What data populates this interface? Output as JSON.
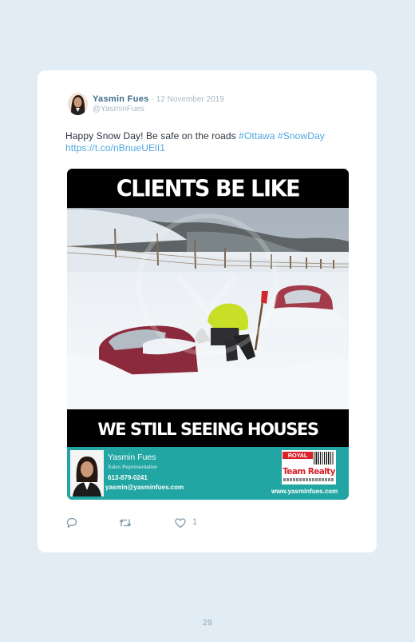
{
  "tweet": {
    "display_name": "Yasmin Fues",
    "date": "· 12 November 2019",
    "handle": "@YasminFues",
    "text_plain": "Happy Snow Day! Be safe on the roads ",
    "hashtag_1": "#Ottawa",
    "hashtag_2": "#SnowDay",
    "link": "https://t.co/nBnueUElI1",
    "reply_icon": "speech-bubble-icon",
    "retweet_icon": "retweet-icon",
    "like_icon": "heart-icon",
    "like_count": "1"
  },
  "media": {
    "top_caption": "CLIENTS BE LIKE",
    "bottom_caption": "WE STILL SEEING HOUSES TODAY?",
    "agent_name": "Yasmin Fues",
    "agent_title": "Sales Representative",
    "agent_phone": "613-879-0241",
    "agent_email": "yasmin@yasminfues.com",
    "brokerage_royal": "ROYAL LEPAGE",
    "brokerage_team": "Team Realty",
    "agent_website": "www.yasminfues.com"
  },
  "page": {
    "number": "29"
  },
  "colors": {
    "page_bg": "#e1ecf4",
    "card_bg": "#ffffff",
    "name": "#3d6d8a",
    "link": "#4fa7df",
    "banner": "#22a6a3",
    "brand_red": "#d8232a"
  }
}
